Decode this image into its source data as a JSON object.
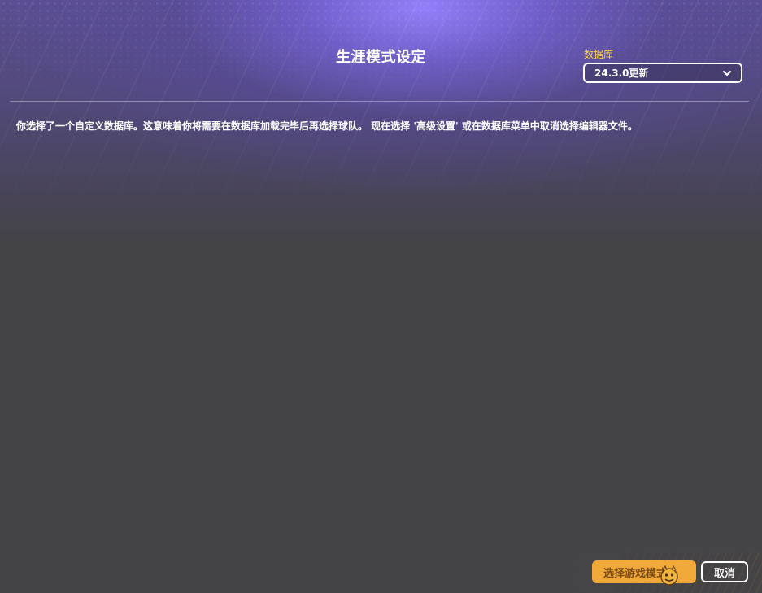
{
  "header": {
    "title": "生涯模式设定"
  },
  "database": {
    "label": "数据库",
    "selected": "24.3.0更新"
  },
  "main": {
    "message": "你选择了一个自定义数据库。这意味着你将需要在数据库加载完毕后再选择球队。 现在选择 '高级设置' 或在数据库菜单中取消选择编辑器文件。"
  },
  "footer": {
    "select_mode_label": "选择游戏模式",
    "cancel_label": "取消"
  },
  "colors": {
    "background": "#444346",
    "accent_yellow": "#f7d44a",
    "primary_button": "#f1a93a"
  },
  "icons": {
    "dropdown": "chevron-down-icon",
    "watermark": "mascot-logo-icon"
  }
}
